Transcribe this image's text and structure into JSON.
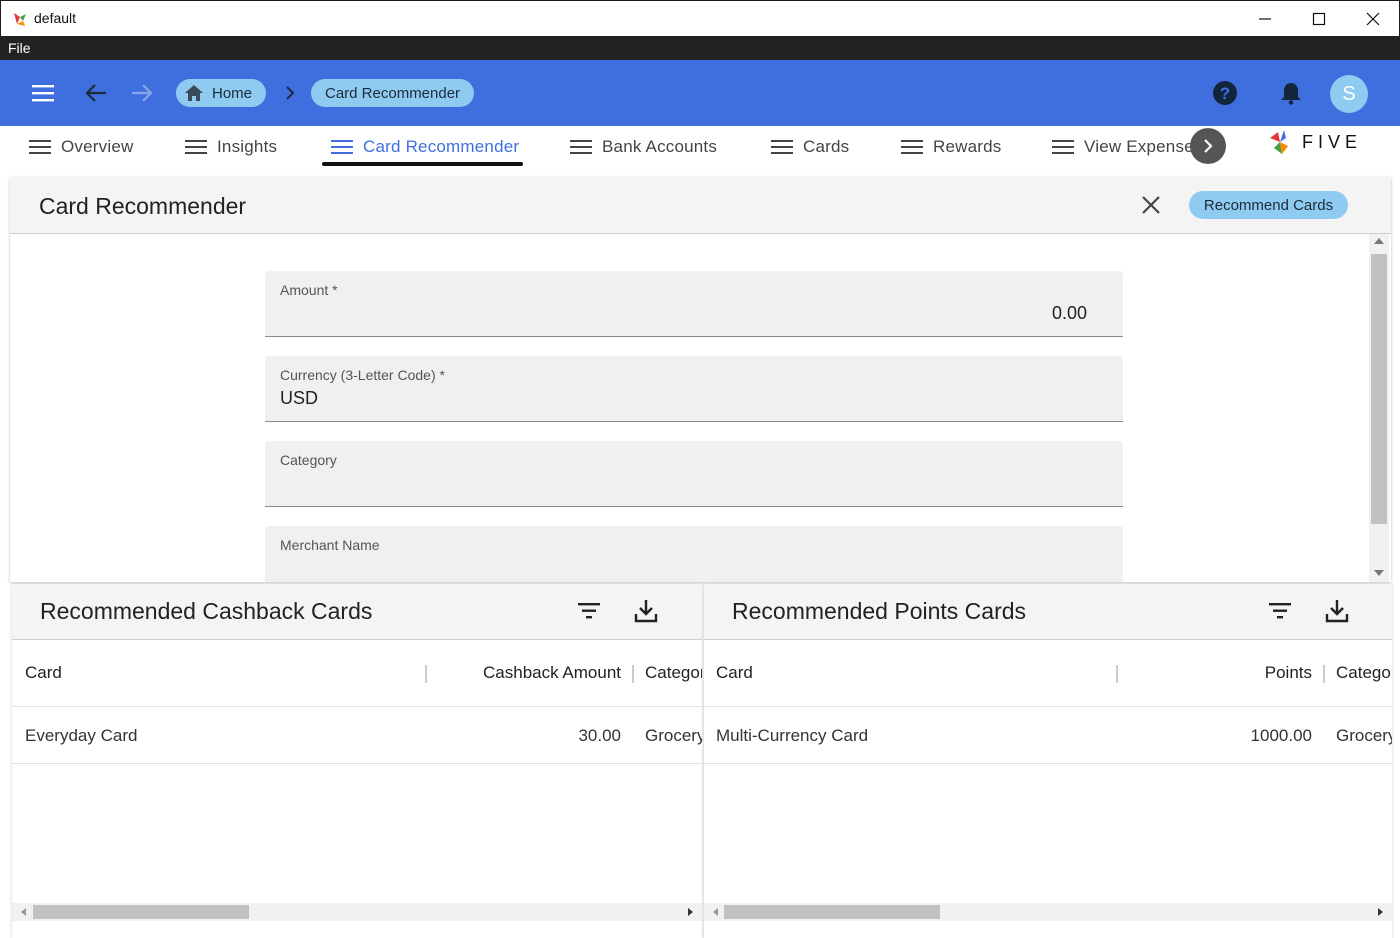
{
  "window": {
    "title": "default",
    "minimize_icon": "minimize-icon",
    "maximize_icon": "maximize-icon",
    "close_icon": "close-icon"
  },
  "menubar": {
    "file": "File"
  },
  "appbar": {
    "color": "#3f6fdf",
    "breadcrumb": {
      "home": "Home",
      "current": "Card Recommender"
    },
    "avatar_initial": "S",
    "icons": [
      "menu-icon",
      "back-arrow-icon",
      "forward-arrow-icon",
      "home-icon",
      "chevron-right-icon",
      "help-icon",
      "bell-icon"
    ]
  },
  "tabs": {
    "items": [
      {
        "label": "Overview"
      },
      {
        "label": "Insights"
      },
      {
        "label": "Card Recommender",
        "active": true
      },
      {
        "label": "Bank Accounts"
      },
      {
        "label": "Cards"
      },
      {
        "label": "Rewards"
      },
      {
        "label": "View Expenses"
      }
    ],
    "logo_text": "FIVE"
  },
  "form": {
    "title": "Card Recommender",
    "recommend_button": "Recommend Cards",
    "fields": [
      {
        "label": "Amount *",
        "value": "0.00"
      },
      {
        "label": "Currency (3-Letter Code) *",
        "value": "USD"
      },
      {
        "label": "Category",
        "value": ""
      },
      {
        "label": "Merchant Name",
        "value": ""
      }
    ]
  },
  "cashback": {
    "title": "Recommended Cashback Cards",
    "columns": [
      "Card",
      "Cashback Amount",
      "Categor"
    ],
    "rows": [
      {
        "card": "Everyday Card",
        "amount": "30.00",
        "category": "Grocery"
      }
    ]
  },
  "points": {
    "title": "Recommended Points Cards",
    "columns": [
      "Card",
      "Points",
      "Categor"
    ],
    "rows": [
      {
        "card": "Multi-Currency Card",
        "points": "1000.00",
        "category": "Grocery"
      }
    ]
  }
}
